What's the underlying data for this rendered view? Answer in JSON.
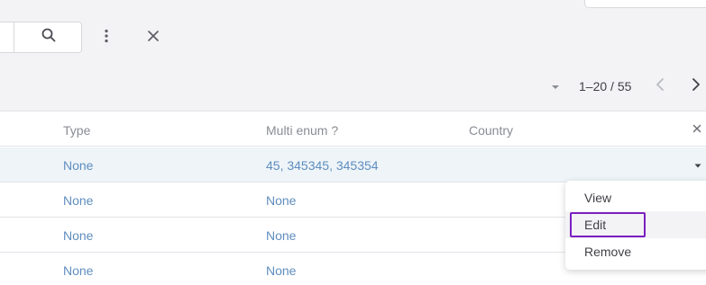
{
  "toolbar": {
    "search_placeholder": "",
    "pagination": {
      "range_label": "1–20 / 55"
    }
  },
  "icons": {
    "search": "search-icon",
    "more": "more-vertical-icon",
    "close": "close-icon",
    "dropdown": "caret-down-icon",
    "prev": "chevron-left-icon",
    "next": "chevron-right-icon"
  },
  "table": {
    "columns": [
      {
        "label": "Type"
      },
      {
        "label": "Multi enum ?"
      },
      {
        "label": "Country"
      }
    ],
    "rows": [
      {
        "type": "None",
        "multi_enum": "45, 345345, 345354",
        "country": ""
      },
      {
        "type": "None",
        "multi_enum": "None",
        "country": ""
      },
      {
        "type": "None",
        "multi_enum": "None",
        "country": ""
      },
      {
        "type": "None",
        "multi_enum": "None",
        "country": ""
      }
    ]
  },
  "row_menu": {
    "items": [
      {
        "label": "View"
      },
      {
        "label": "Edit"
      },
      {
        "label": "Remove"
      }
    ]
  },
  "colors": {
    "toolbar_bg": "#f3f3f5",
    "link": "#5f8dbf",
    "selected_row_bg": "#eef4f8",
    "focus_ring": "#7a1fc0"
  }
}
